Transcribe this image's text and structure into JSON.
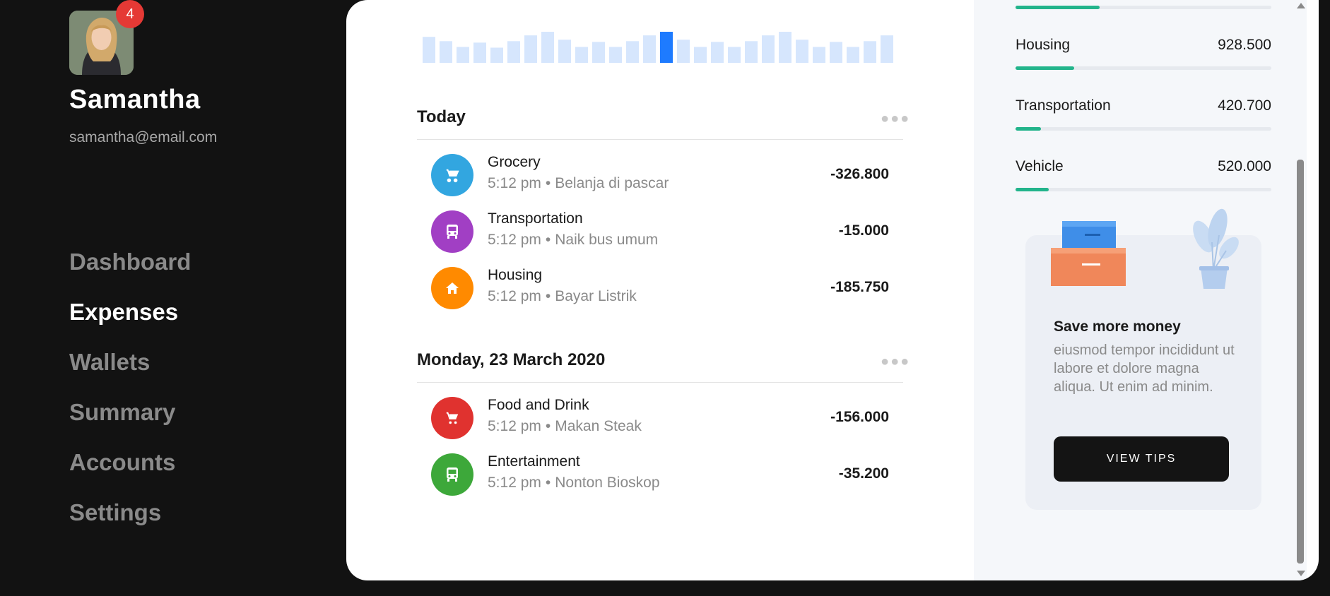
{
  "user": {
    "name": "Samantha",
    "email": "samantha@email.com",
    "notifications": "4"
  },
  "nav": {
    "items": [
      "Dashboard",
      "Expenses",
      "Wallets",
      "Summary",
      "Accounts",
      "Settings"
    ],
    "active": "Expenses"
  },
  "chart_data": {
    "type": "bar",
    "values": [
      36,
      30,
      22,
      28,
      21,
      30,
      38,
      43,
      32,
      22,
      29,
      22,
      30,
      38,
      43,
      32,
      22,
      29,
      22,
      30,
      38,
      43,
      32,
      22,
      29,
      22,
      30,
      38
    ],
    "highlight_index": 14,
    "bar_color": "#d6e6fd",
    "highlight_color": "#1e7bff"
  },
  "groups": [
    {
      "title": "Today",
      "transactions": [
        {
          "title": "Grocery",
          "time": "5:12 pm",
          "note": "Belanja di pascar",
          "amount": "-326.800",
          "icon": "cart-icon",
          "color": "#32a6e0"
        },
        {
          "title": "Transportation",
          "time": "5:12 pm",
          "note": "Naik bus umum",
          "amount": "-15.000",
          "icon": "bus-icon",
          "color": "#a13fc4"
        },
        {
          "title": "Housing",
          "time": "5:12 pm",
          "note": "Bayar Listrik",
          "amount": "-185.750",
          "icon": "home-icon",
          "color": "#ff8a00"
        }
      ]
    },
    {
      "title": "Monday, 23 March 2020",
      "transactions": [
        {
          "title": "Food and Drink",
          "time": "5:12 pm",
          "note": "Makan Steak",
          "amount": "-156.000",
          "icon": "cart-icon",
          "color": "#e0322f"
        },
        {
          "title": "Entertainment",
          "time": "5:12 pm",
          "note": "Nonton Bioskop",
          "amount": "-35.200",
          "icon": "bus-icon",
          "color": "#3da83a"
        }
      ]
    }
  ],
  "categories": [
    {
      "name": "Housing",
      "value": "928.500",
      "progress": 0.23
    },
    {
      "name": "Transportation",
      "value": "420.700",
      "progress": 0.1
    },
    {
      "name": "Vehicle",
      "value": "520.000",
      "progress": 0.13
    }
  ],
  "top_partial_progress": 0.33,
  "tips": {
    "title": "Save more money",
    "body": "eiusmod tempor incididunt ut labore et dolore magna aliqua. Ut enim ad minim.",
    "button": "VIEW TIPS"
  },
  "colors": {
    "accent": "#22b48b",
    "background": "#121212"
  }
}
